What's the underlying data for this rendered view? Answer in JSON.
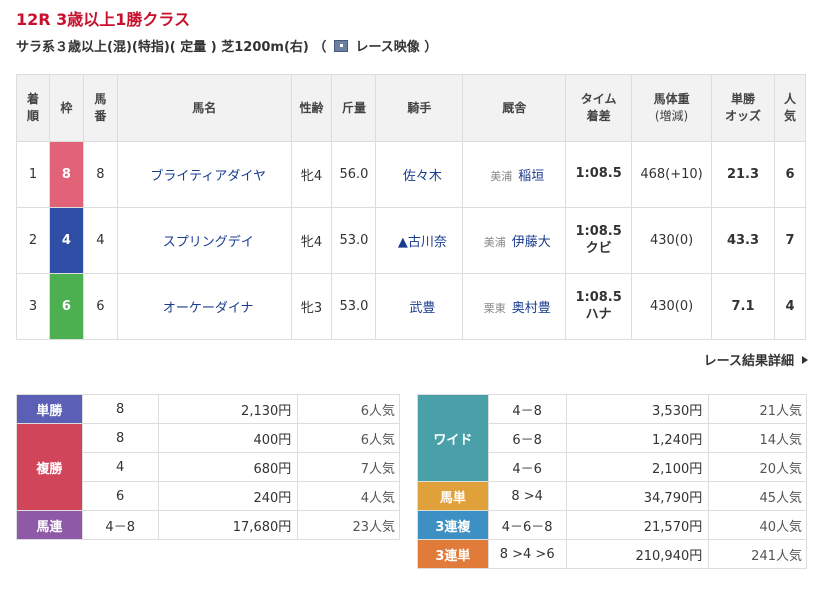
{
  "race": {
    "title": "12R 3歳以上1勝クラス",
    "subtitle": "サラ系３歳以上(混)(特指)( 定量 ) 芝1200m(右) （",
    "video_label": "レース映像 ）"
  },
  "table": {
    "headers": {
      "rank": "着順",
      "waku": "枠",
      "umaban": "馬番",
      "horse": "馬名",
      "sexage": "性齢",
      "weight": "斤量",
      "jockey": "騎手",
      "trainer": "厩舎",
      "time": "タイム着差",
      "bodyweight": "馬体重(増減)",
      "odds": "単勝オッズ",
      "pop": "人気"
    },
    "rows": [
      {
        "rank": "1",
        "waku": "8",
        "waku_color": "#e06377",
        "umaban": "8",
        "horse": "ブライティアダイヤ",
        "sexage": "牝4",
        "weight": "56.0",
        "jockey": "佐々木",
        "region": "美浦",
        "trainer": "稲垣",
        "time": "1:08.5",
        "margin": "",
        "bodyweight": "468(+10)",
        "odds": "21.3",
        "pop": "6"
      },
      {
        "rank": "2",
        "waku": "4",
        "waku_color": "#2f4fa6",
        "umaban": "4",
        "horse": "スプリングデイ",
        "sexage": "牝4",
        "weight": "53.0",
        "jockey": "▲古川奈",
        "region": "美浦",
        "trainer": "伊藤大",
        "time": "1:08.5",
        "margin": "クビ",
        "bodyweight": "430(0)",
        "odds": "43.3",
        "pop": "7"
      },
      {
        "rank": "3",
        "waku": "6",
        "waku_color": "#4caf50",
        "umaban": "6",
        "horse": "オーケーダイナ",
        "sexage": "牝3",
        "weight": "53.0",
        "jockey": "武豊",
        "region": "栗東",
        "trainer": "奥村豊",
        "time": "1:08.5",
        "margin": "ハナ",
        "bodyweight": "430(0)",
        "odds": "7.1",
        "pop": "4"
      }
    ]
  },
  "detail_link": "レース結果詳細",
  "payouts_left": {
    "tansho": {
      "label": "単勝",
      "color": "#5b5fb5",
      "rows": [
        {
          "num": "8",
          "amt": "2,130円",
          "pop": "6人気"
        }
      ]
    },
    "fukusho": {
      "label": "複勝",
      "color": "#d0455a",
      "rows": [
        {
          "num": "8",
          "amt": "400円",
          "pop": "6人気"
        },
        {
          "num": "4",
          "amt": "680円",
          "pop": "7人気"
        },
        {
          "num": "6",
          "amt": "240円",
          "pop": "4人気"
        }
      ]
    },
    "umaren": {
      "label": "馬連",
      "color": "#8e5aa8",
      "rows": [
        {
          "num": "4－8",
          "amt": "17,680円",
          "pop": "23人気"
        }
      ]
    }
  },
  "payouts_right": {
    "wide": {
      "label": "ワイド",
      "color": "#4aa0a8",
      "rows": [
        {
          "num": "4－8",
          "amt": "3,530円",
          "pop": "21人気"
        },
        {
          "num": "6－8",
          "amt": "1,240円",
          "pop": "14人気"
        },
        {
          "num": "4－6",
          "amt": "2,100円",
          "pop": "20人気"
        }
      ]
    },
    "umatan": {
      "label": "馬単",
      "color": "#e0a13a",
      "rows": [
        {
          "num": "8 >4",
          "amt": "34,790円",
          "pop": "45人気"
        }
      ]
    },
    "sanrenpuku": {
      "label": "3連複",
      "color": "#3d8fc4",
      "rows": [
        {
          "num": "4－6－8",
          "amt": "21,570円",
          "pop": "40人気"
        }
      ]
    },
    "sanrentan": {
      "label": "3連単",
      "color": "#e07b3a",
      "rows": [
        {
          "num": "8 >4 >6",
          "amt": "210,940円",
          "pop": "241人気"
        }
      ]
    }
  }
}
